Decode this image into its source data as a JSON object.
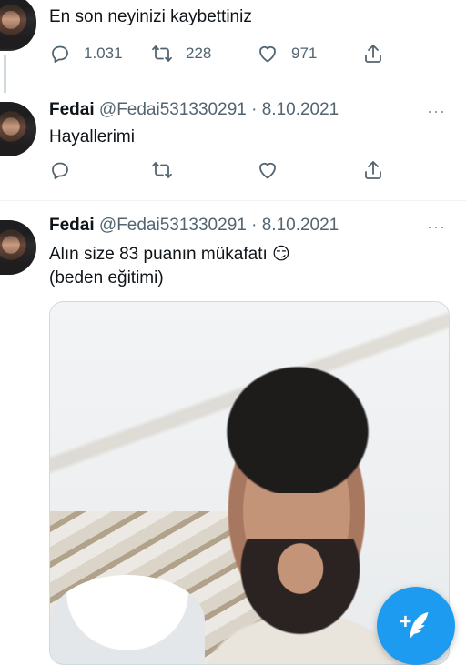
{
  "tweets": [
    {
      "text": "En son neyinizi kaybettiniz",
      "actions": {
        "reply_count": "1.031",
        "retweet_count": "228",
        "like_count": "971"
      }
    },
    {
      "name": "Fedai",
      "handle": "@Fedai531330291",
      "separator": "·",
      "date": "8.10.2021",
      "text": "Hayallerimi",
      "more": "···"
    },
    {
      "name": "Fedai",
      "handle": "@Fedai531330291",
      "separator": "·",
      "date": "8.10.2021",
      "text_line1": "Alın size 83 puanın mükafatı 😏",
      "text_line2": "(beden eğitimi)",
      "more": "···"
    }
  ],
  "fab": {
    "icon": "compose-tweet-icon",
    "color": "#1d9bf0"
  },
  "colors": {
    "accent": "#1d9bf0",
    "secondary_text": "#536471"
  }
}
